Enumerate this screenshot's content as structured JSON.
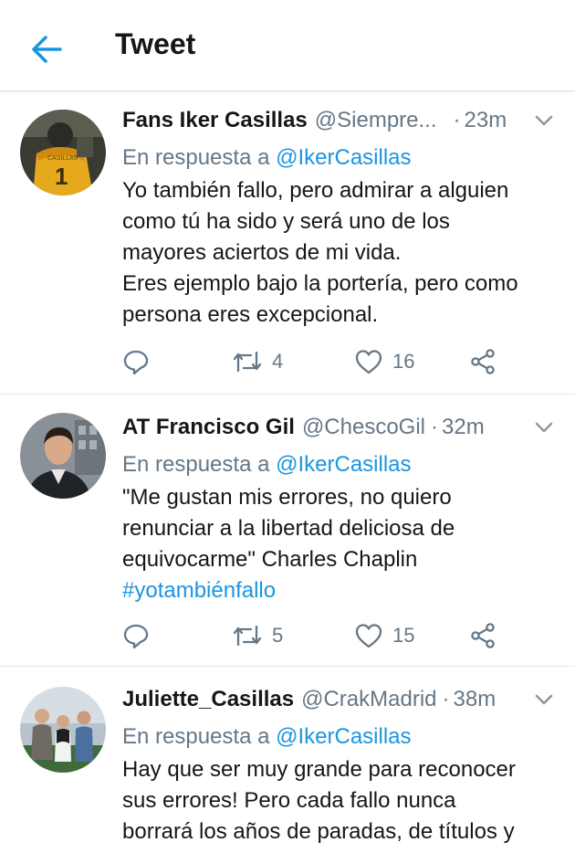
{
  "header": {
    "title": "Tweet"
  },
  "colors": {
    "accent": "#1b95e0",
    "muted": "#657786",
    "text": "#14171a"
  },
  "tweets": [
    {
      "name": "Fans Iker Casillas",
      "handle": "@Siempre...",
      "dot": "·",
      "time": "23m",
      "reply_prefix": "En respuesta a",
      "reply_to": "@IkerCasillas",
      "lines": [
        "Yo también fallo, pero admirar a alguien",
        "como tú ha sido y será uno de los",
        "mayores aciertos de mi vida.",
        "Eres ejemplo bajo la portería, pero como",
        "persona eres excepcional."
      ],
      "retweets": "4",
      "likes": "16",
      "avatar_icon": "goalkeeper-photo"
    },
    {
      "name": "AT Francisco Gil",
      "handle": "@ChescoGil",
      "dot": "·",
      "time": "32m",
      "reply_prefix": "En respuesta a",
      "reply_to": "@IkerCasillas",
      "lines": [
        "\"Me gustan mis errores, no quiero",
        "renunciar a la libertad deliciosa de",
        "equivocarme\" Charles Chaplin"
      ],
      "hashtag": "#yotambiénfallo",
      "retweets": "5",
      "likes": "15",
      "avatar_icon": "man-portrait-photo"
    },
    {
      "name": "Juliette_Casillas",
      "handle": "@CrakMadrid",
      "dot": "·",
      "time": "38m",
      "reply_prefix": "En respuesta a",
      "reply_to": "@IkerCasillas",
      "lines": [
        "Hay que ser muy grande para reconocer",
        "sus errores! Pero cada fallo nunca",
        "borrará los años de paradas, de títulos y"
      ],
      "avatar_icon": "group-photo"
    }
  ]
}
